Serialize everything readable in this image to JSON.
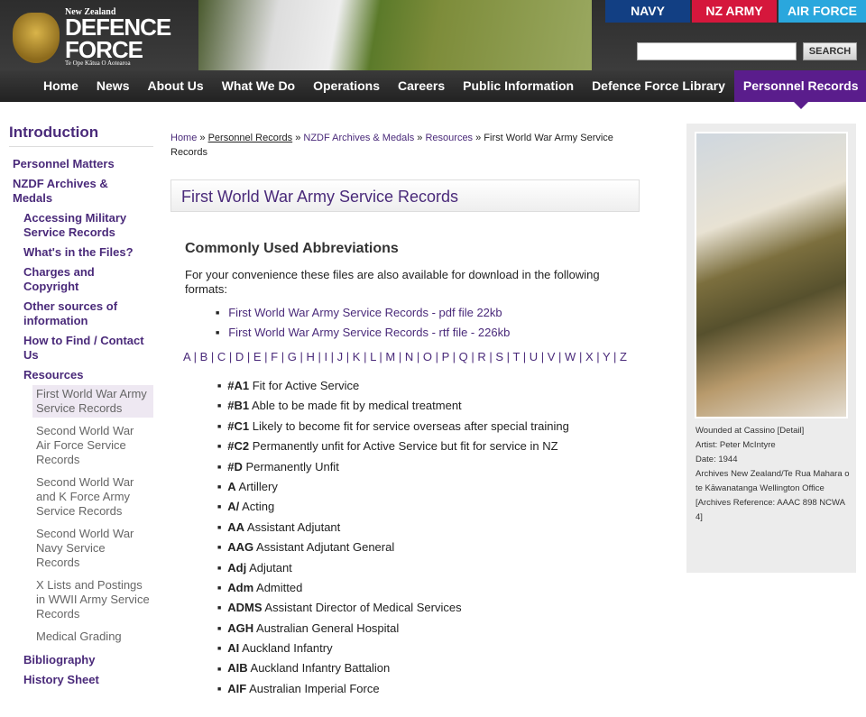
{
  "header": {
    "logo": {
      "line1": "New Zealand",
      "line2": "DEFENCE FORCE",
      "line3": "Te Ope Kātua O Aotearoa"
    },
    "services": [
      "NAVY",
      "NZ ARMY",
      "AIR FORCE"
    ],
    "search": {
      "value": "",
      "button": "SEARCH"
    }
  },
  "nav": [
    "Home",
    "News",
    "About Us",
    "What We Do",
    "Operations",
    "Careers",
    "Public Information",
    "Defence Force Library",
    "Personnel Records"
  ],
  "nav_active": "Personnel Records",
  "sidebar": {
    "title": "Introduction",
    "items": [
      "Personnel Matters",
      "NZDF Archives & Medals"
    ],
    "sub": [
      "Accessing Military Service Records",
      "What's in the Files?",
      "Charges and Copyright",
      "Other sources of information",
      "How to Find / Contact Us",
      "Resources"
    ],
    "resources": [
      "First World War Army Service Records",
      "Second World War Air Force Service Records",
      "Second World War and K Force Army Service Records",
      "Second World War Navy Service Records",
      "X Lists and Postings in WWII Army Service Records",
      "Medical Grading"
    ],
    "after": [
      "Bibliography",
      "History Sheet"
    ]
  },
  "breadcrumb": [
    "Home",
    "Personnel Records",
    "NZDF Archives & Medals",
    "Resources",
    "First World War Army Service Records"
  ],
  "main": {
    "title": "First World War Army Service Records",
    "heading": "Commonly Used Abbreviations",
    "intro": "For your convenience these files are also available for download in the following formats:",
    "downloads": [
      "First World War Army Service Records - pdf file 22kb",
      "First World War Army Service Records - rtf file - 226kb"
    ],
    "alphabet": [
      "A",
      "B",
      "C",
      "D",
      "E",
      "F",
      "G",
      "H",
      "I",
      "J",
      "K",
      "L",
      "M",
      "N",
      "O",
      "P",
      "Q",
      "R",
      "S",
      "T",
      "U",
      "V",
      "W",
      "X",
      "Y",
      "Z"
    ],
    "abbreviations": [
      [
        "#A1",
        "Fit for Active Service"
      ],
      [
        "#B1",
        "Able to be made fit by medical treatment"
      ],
      [
        "#C1",
        "Likely to become fit for service overseas after special training"
      ],
      [
        "#C2",
        "Permanently unfit for Active Service but fit for service in NZ"
      ],
      [
        "#D",
        "Permanently Unfit"
      ],
      [
        "A",
        "Artillery"
      ],
      [
        "A/",
        "Acting"
      ],
      [
        "AA",
        "Assistant Adjutant"
      ],
      [
        "AAG",
        "Assistant Adjutant General"
      ],
      [
        "Adj",
        "Adjutant"
      ],
      [
        "Adm",
        "Admitted"
      ],
      [
        "ADMS",
        "Assistant Director of Medical Services"
      ],
      [
        "AGH",
        "Australian General Hospital"
      ],
      [
        "AI",
        "Auckland Infantry"
      ],
      [
        "AIB",
        "Auckland Infantry Battalion"
      ],
      [
        "AIF",
        "Australian Imperial Force"
      ]
    ]
  },
  "aside": {
    "caption": [
      "Wounded at Cassino [Detail]",
      "Artist: Peter McIntyre",
      "Date: 1944",
      "Archives New Zealand/Te Rua Mahara o te Kāwanatanga Wellington Office [Archives Reference: AAAC 898 NCWA 4]"
    ]
  }
}
